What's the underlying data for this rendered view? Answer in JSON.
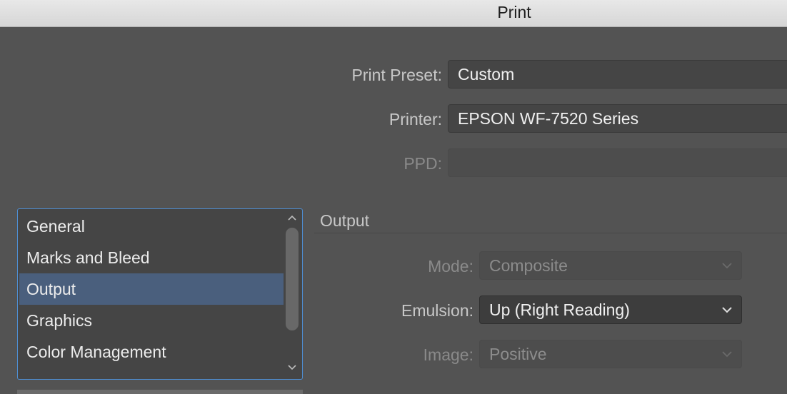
{
  "window": {
    "title": "Print"
  },
  "print_preset": {
    "label": "Print Preset:",
    "value": "Custom"
  },
  "printer": {
    "label": "Printer:",
    "value": "EPSON WF-7520 Series"
  },
  "ppd": {
    "label": "PPD:",
    "value": ""
  },
  "sidebar": {
    "items": [
      {
        "label": "General"
      },
      {
        "label": "Marks and Bleed"
      },
      {
        "label": "Output",
        "selected": true
      },
      {
        "label": "Graphics"
      },
      {
        "label": "Color Management"
      }
    ]
  },
  "output": {
    "section_title": "Output",
    "mode": {
      "label": "Mode:",
      "value": "Composite",
      "enabled": false
    },
    "emulsion": {
      "label": "Emulsion:",
      "value": "Up (Right Reading)",
      "enabled": true
    },
    "image": {
      "label": "Image:",
      "value": "Positive",
      "enabled": false
    }
  },
  "colors": {
    "selection": "#4a5f7d",
    "focus_border": "#4e8ed3",
    "background": "#535353"
  }
}
